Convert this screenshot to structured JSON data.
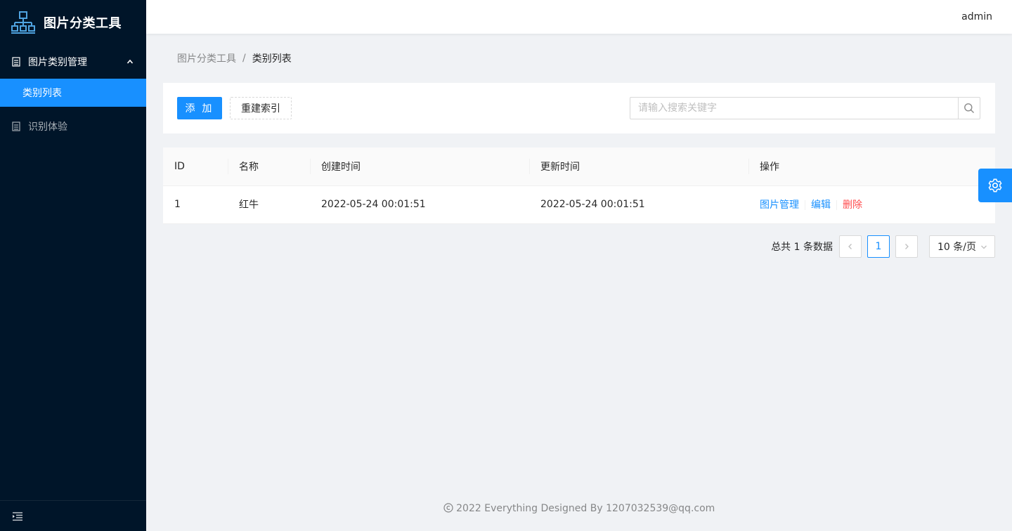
{
  "app": {
    "title": "图片分类工具"
  },
  "sidebar": {
    "group": {
      "label": "图片类别管理"
    },
    "group_items": [
      {
        "label": "类别列表"
      }
    ],
    "items": [
      {
        "label": "识别体验"
      }
    ]
  },
  "header": {
    "user": "admin"
  },
  "breadcrumb": {
    "root": "图片分类工具",
    "separator": "/",
    "current": "类别列表"
  },
  "toolbar": {
    "add_label": "添 加",
    "rebuild_label": "重建索引",
    "search_placeholder": "请输入搜索关键字"
  },
  "table": {
    "columns": [
      "ID",
      "名称",
      "创建时间",
      "更新时间",
      "操作"
    ],
    "rows": [
      {
        "id": "1",
        "name": "红牛",
        "created": "2022-05-24 00:01:51",
        "updated": "2022-05-24 00:01:51",
        "actions": [
          "图片管理",
          "编辑",
          "删除"
        ]
      }
    ]
  },
  "pagination": {
    "total_text": "总共 1 条数据",
    "current_page": "1",
    "page_size": "10 条/页"
  },
  "footer": {
    "copyright": "2022 Everything Designed By 1207032539@qq.com"
  },
  "colors": {
    "primary": "#1890ff",
    "sider_bg": "#001529",
    "danger": "#ff4d4f"
  },
  "icons": [
    "logo-icon",
    "menu-group-icon",
    "chevron-up-icon",
    "menu-item-icon",
    "collapse-menu-icon",
    "search-icon",
    "chevron-left-icon",
    "chevron-right-icon",
    "chevron-down-icon",
    "gear-icon",
    "copyright-icon"
  ]
}
